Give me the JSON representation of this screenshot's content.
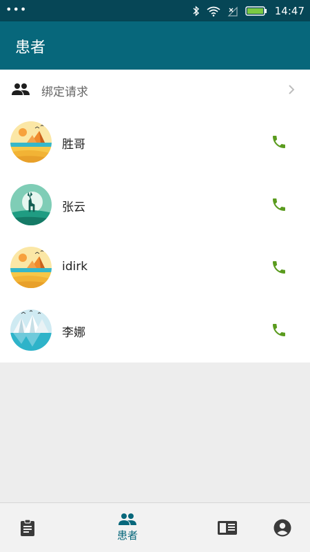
{
  "status_bar": {
    "time": "14:47",
    "menu_dots": "•••"
  },
  "header": {
    "title": "患者"
  },
  "bind_request": {
    "label": "绑定请求",
    "icon": "group-icon"
  },
  "patients": [
    {
      "name": "胜哥",
      "avatar": "desert-avatar"
    },
    {
      "name": "张云",
      "avatar": "deer-avatar"
    },
    {
      "name": "idirk",
      "avatar": "desert-avatar"
    },
    {
      "name": "李娜",
      "avatar": "mountain-avatar"
    }
  ],
  "tabs": [
    {
      "icon": "clipboard-icon",
      "label": ""
    },
    {
      "icon": "group-icon",
      "label": "患者",
      "active": true
    },
    {
      "icon": "newspaper-icon",
      "label": ""
    },
    {
      "icon": "account-icon",
      "label": ""
    }
  ],
  "colors": {
    "primary": "#07677b",
    "status_bar": "#064656",
    "call": "#5a9b1e"
  }
}
